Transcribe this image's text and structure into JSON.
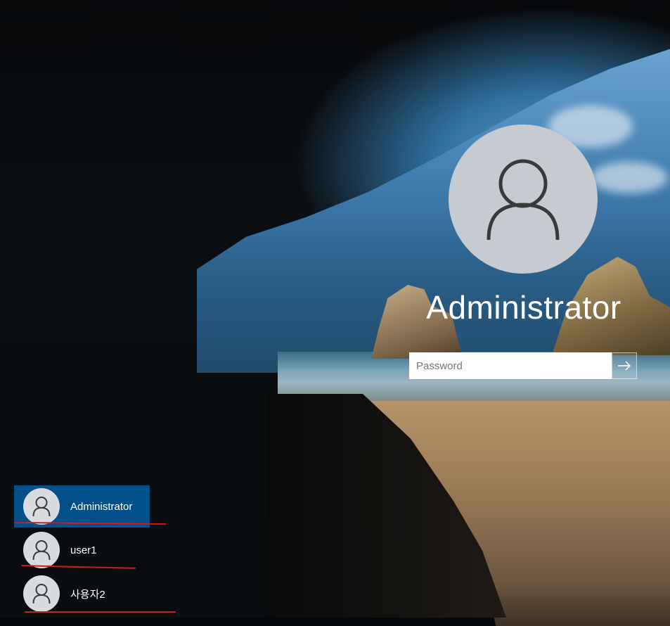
{
  "login": {
    "user_name": "Administrator",
    "password_placeholder": "Password",
    "submit_icon": "arrow-right-icon"
  },
  "users": [
    {
      "name": "Administrator",
      "selected": true
    },
    {
      "name": "user1",
      "selected": false
    },
    {
      "name": "사용자2",
      "selected": false
    }
  ],
  "colors": {
    "selected_user_bg": "#00508a",
    "avatar_bg": "#c5cbd1",
    "annotation_underline": "#d4181c"
  }
}
